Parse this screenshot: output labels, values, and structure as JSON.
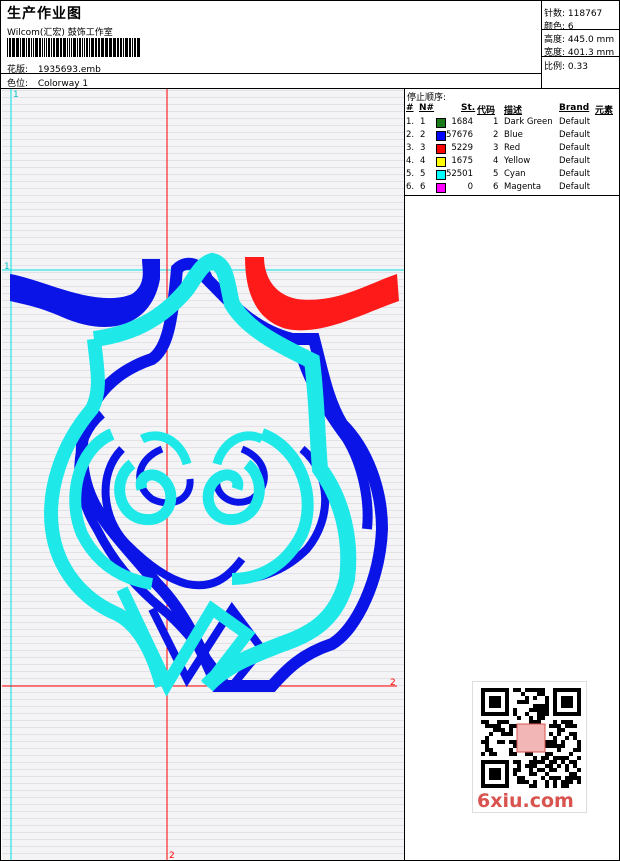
{
  "header": {
    "title": "生产作业图",
    "company": "Wilcom(汇宏) 鼓饰工作室",
    "design_label": "花版:",
    "design_value": "1935693.emb",
    "colorway_label": "色位:",
    "colorway_value": "Colorway 1"
  },
  "stats": [
    {
      "label": "针数",
      "value": "118767"
    },
    {
      "label": "颜色",
      "value": "6"
    },
    {
      "label": "高度",
      "value": "445.0 mm"
    },
    {
      "label": "宽度",
      "value": "401.3 mm"
    },
    {
      "label": "比例",
      "value": "0.33"
    }
  ],
  "canvas": {
    "marker_top_left": "1",
    "marker_left_mid": "1",
    "marker_right": "2",
    "marker_bottom": "2"
  },
  "color_table": {
    "title": "停止顺序:",
    "headers": {
      "num": "#",
      "n": "N#",
      "st": "St.",
      "code": "代码",
      "desc": "描述",
      "brand": "Brand",
      "elem": "元素"
    },
    "rows": [
      {
        "num": "1.",
        "n": "1",
        "st": "1684",
        "code": "1",
        "desc": "Dark Green",
        "brand": "Default",
        "color": "#1a7a1a"
      },
      {
        "num": "2.",
        "n": "2",
        "st": "57676",
        "code": "2",
        "desc": "Blue",
        "brand": "Default",
        "color": "#0000ff"
      },
      {
        "num": "3.",
        "n": "3",
        "st": "5229",
        "code": "3",
        "desc": "Red",
        "brand": "Default",
        "color": "#ff0000"
      },
      {
        "num": "4.",
        "n": "4",
        "st": "1675",
        "code": "4",
        "desc": "Yellow",
        "brand": "Default",
        "color": "#ffff00"
      },
      {
        "num": "5.",
        "n": "5",
        "st": "52501",
        "code": "5",
        "desc": "Cyan",
        "brand": "Default",
        "color": "#00ffff"
      },
      {
        "num": "6.",
        "n": "6",
        "st": "0",
        "code": "6",
        "desc": "Magenta",
        "brand": "Default",
        "color": "#ff00ff"
      }
    ]
  },
  "watermark": "6xiu.com",
  "colors": {
    "blue": "#0a14e6",
    "red": "#ff1a1a",
    "cyan": "#1ee8e8",
    "guide_red": "#ff0000",
    "guide_cyan": "#00e0e0"
  }
}
